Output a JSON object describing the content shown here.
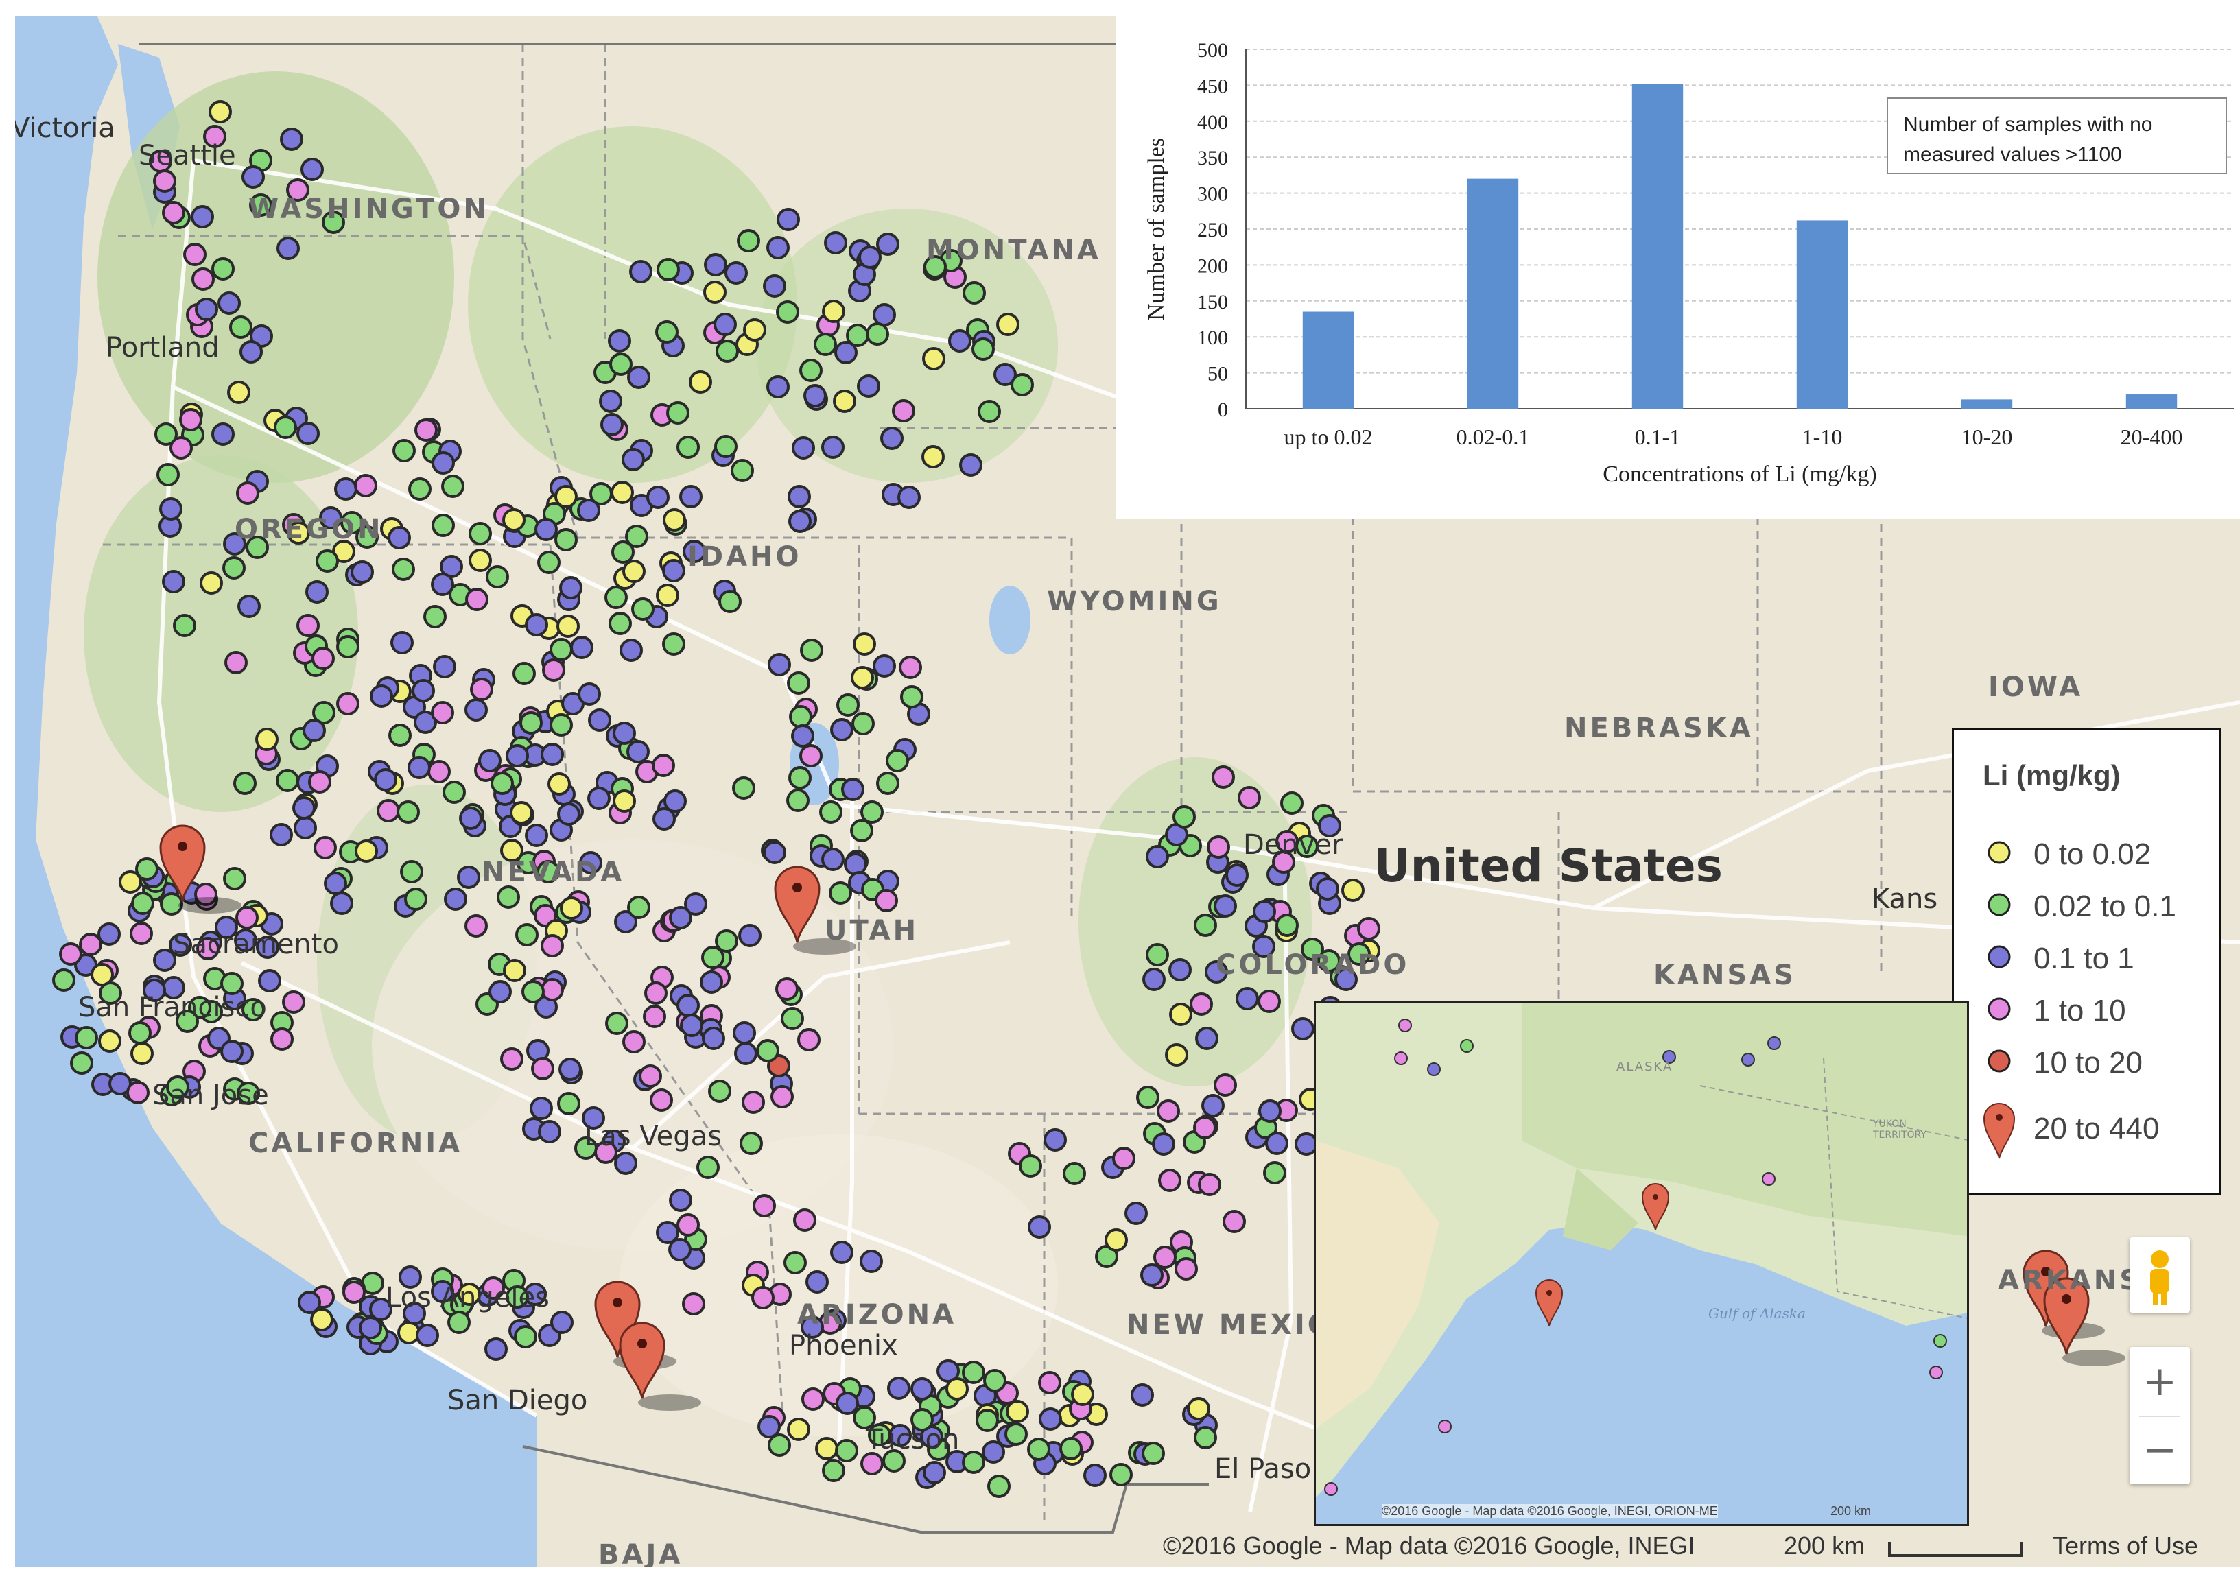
{
  "map": {
    "state_labels": [
      "WASHINGTON",
      "MONTANA",
      "OREGON",
      "IDAHO",
      "WYOMING",
      "NEBRASKA",
      "IOWA",
      "NEVADA",
      "UTAH",
      "COLORADO",
      "KANSAS",
      "CALIFORNIA",
      "ARIZONA",
      "NEW MEXICO",
      "ARKANSAS",
      "BAJA"
    ],
    "city_labels": [
      "Victoria",
      "Seattle",
      "Portland",
      "Sacramento",
      "San Francisco",
      "San Jose",
      "Los Angeles",
      "San Diego",
      "Las Vegas",
      "Phoenix",
      "Tucson",
      "El Paso",
      "Denver",
      "Kans"
    ],
    "country_label": "United States",
    "attribution": "©2016 Google - Map data ©2016 Google, INEGI",
    "scale_label": "200 km",
    "terms": "Terms of Use",
    "inset_attribution": "©2016 Google - Map data ©2016 Google, INEGI, ORION-ME",
    "inset_scale": "200 km",
    "inset_labels": [
      "ALASKA",
      "YUKON TERRITORY",
      "Gulf of Alaska"
    ],
    "controls": {
      "zoom_in": "+",
      "zoom_out": "−",
      "pegman_icon": "pegman-icon"
    }
  },
  "legend": {
    "title": "Li (mg/kg)",
    "items": [
      {
        "label": "0 to 0.02",
        "color": "#f2ee7a",
        "marker": "circle"
      },
      {
        "label": "0.02 to 0.1",
        "color": "#86d67a",
        "marker": "circle"
      },
      {
        "label": "0.1 to 1",
        "color": "#7b78d8",
        "marker": "circle"
      },
      {
        "label": "1 to 10",
        "color": "#e48ae0",
        "marker": "circle"
      },
      {
        "label": "10 to 20",
        "color": "#d96050",
        "marker": "circle"
      },
      {
        "label": "20 to 440",
        "color": "#e26a52",
        "marker": "pin"
      }
    ]
  },
  "chart_data": {
    "type": "bar",
    "categories": [
      "up to 0.02",
      "0.02-0.1",
      "0.1-1",
      "1-10",
      "10-20",
      "20-400"
    ],
    "values": [
      135,
      320,
      452,
      262,
      13,
      20
    ],
    "xlabel": "Concentrations of Li (mg/kg)",
    "ylabel": "Number of samples",
    "ylim": [
      0,
      500
    ],
    "yticks": [
      0,
      50,
      100,
      150,
      200,
      250,
      300,
      350,
      400,
      450,
      500
    ],
    "grid": true,
    "bar_color": "#5b8fd0",
    "annotation": "Number of samples with no measured values >1100"
  }
}
